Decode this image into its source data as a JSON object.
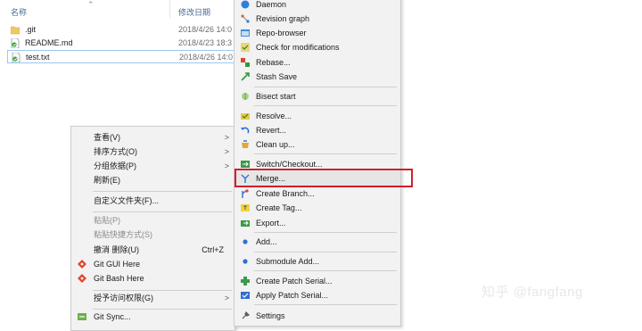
{
  "explorer": {
    "col_name": "名称",
    "col_date": "修改日期",
    "files": [
      {
        "name": ".git",
        "date": "2018/4/26 14:0",
        "icon": "folder-icon"
      },
      {
        "name": "README.md",
        "date": "2018/4/23 18:3",
        "icon": "git-file-icon"
      },
      {
        "name": "test.txt",
        "date": "2018/4/26 14:0",
        "icon": "git-file-icon"
      }
    ]
  },
  "menu1": {
    "items": [
      {
        "label": "查看(V)",
        "arrow": ">"
      },
      {
        "label": "排序方式(O)",
        "arrow": ">"
      },
      {
        "label": "分组依据(P)",
        "arrow": ">"
      },
      {
        "label": "刷新(E)"
      },
      {
        "label": "自定义文件夹(F)..."
      },
      {
        "label": "粘贴(P)",
        "disabled": true
      },
      {
        "label": "粘贴快捷方式(S)",
        "disabled": true
      },
      {
        "label": "撤消 删除(U)",
        "shortcut": "Ctrl+Z"
      },
      {
        "label": "Git GUI Here"
      },
      {
        "label": "Git Bash Here"
      },
      {
        "label": "授予访问权限(G)",
        "arrow": ">"
      },
      {
        "label": "Git Sync..."
      }
    ]
  },
  "menu2": {
    "items": [
      {
        "label": "Daemon"
      },
      {
        "label": "Revision graph"
      },
      {
        "label": "Repo-browser"
      },
      {
        "label": "Check for modifications"
      },
      {
        "label": "Rebase..."
      },
      {
        "label": "Stash Save"
      },
      {
        "label": "Bisect start"
      },
      {
        "label": "Resolve..."
      },
      {
        "label": "Revert..."
      },
      {
        "label": "Clean up..."
      },
      {
        "label": "Switch/Checkout..."
      },
      {
        "label": "Merge..."
      },
      {
        "label": "Create Branch..."
      },
      {
        "label": "Create Tag..."
      },
      {
        "label": "Export..."
      },
      {
        "label": "Add..."
      },
      {
        "label": "Submodule Add..."
      },
      {
        "label": "Create Patch Serial..."
      },
      {
        "label": "Apply Patch Serial..."
      },
      {
        "label": "Settings"
      }
    ]
  },
  "watermark": "知乎 @fangfang"
}
